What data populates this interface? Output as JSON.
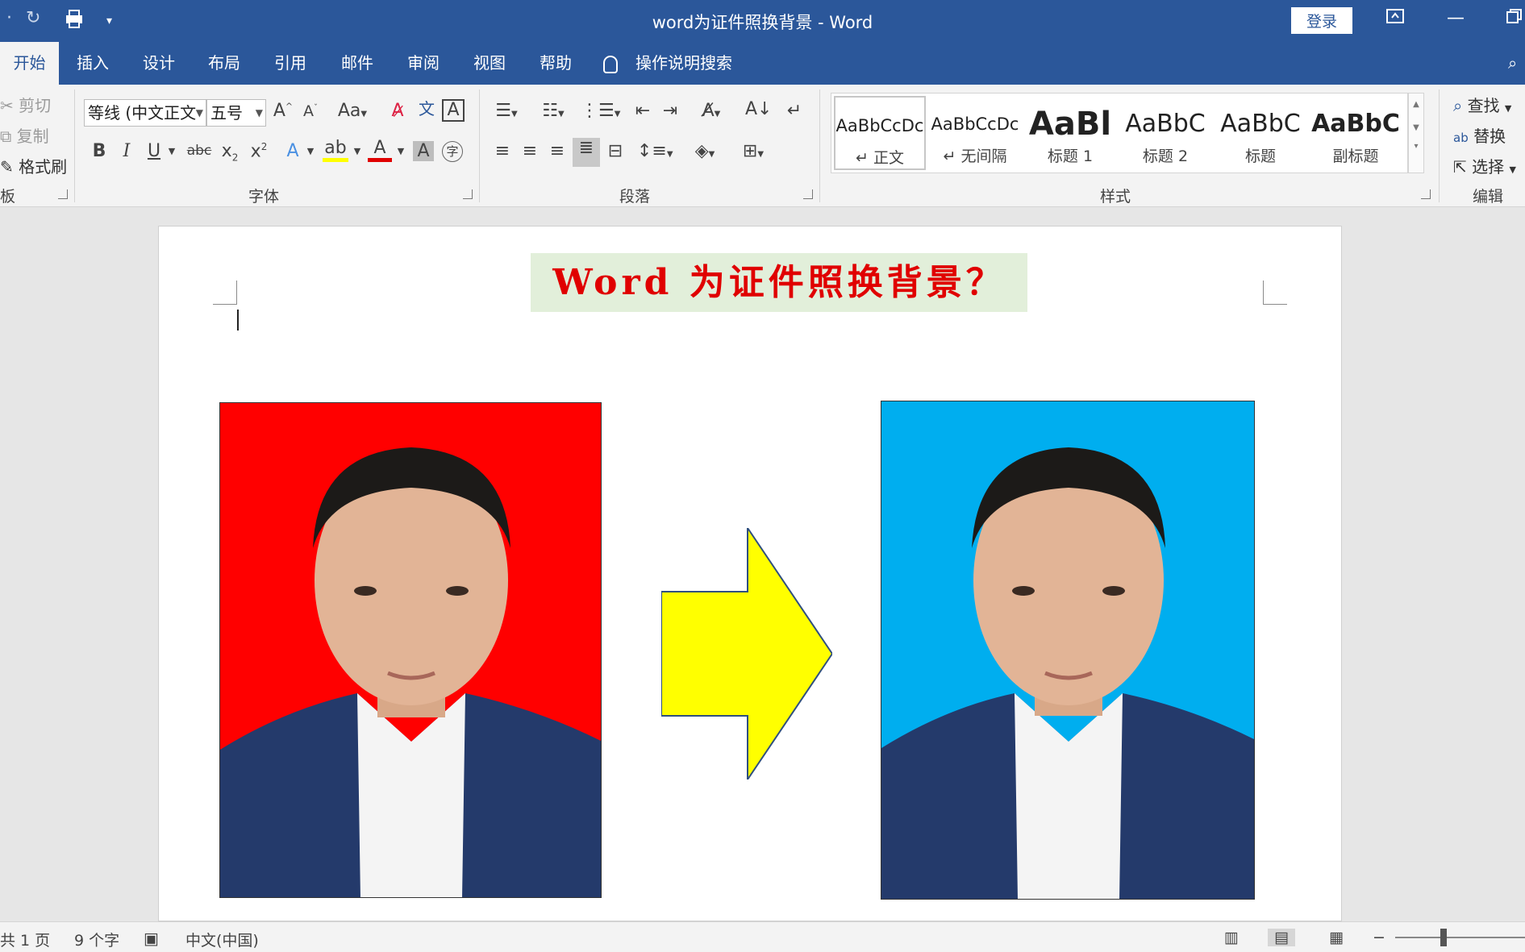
{
  "titlebar": {
    "title": "word为证件照换背景  -  Word",
    "login": "登录",
    "qat_undo_icon": "undo-icon",
    "qat_redo_icon": "redo-icon",
    "qat_print_icon": "print-preview-icon"
  },
  "tabs": [
    "开始",
    "插入",
    "设计",
    "布局",
    "引用",
    "邮件",
    "审阅",
    "视图",
    "帮助"
  ],
  "tell_me": "操作说明搜索",
  "ribbon": {
    "clipboard": {
      "cut": "剪切",
      "copy": "复制",
      "format_painter": "格式刷",
      "label": "板"
    },
    "font": {
      "name": "等线 (中文正文",
      "size": "五号",
      "label": "字体",
      "change_case": "Aa"
    },
    "paragraph": {
      "label": "段落"
    },
    "styles": {
      "label": "样式",
      "items": [
        {
          "sample": "AaBbCcDc",
          "name": "↵ 正文"
        },
        {
          "sample": "AaBbCcDc",
          "name": "↵ 无间隔"
        },
        {
          "sample": "AaBl",
          "name": "标题 1"
        },
        {
          "sample": "AaBbC",
          "name": "标题 2"
        },
        {
          "sample": "AaBbC",
          "name": "标题"
        },
        {
          "sample": "AaBbC",
          "name": "副标题"
        }
      ]
    },
    "editing": {
      "find": "查找",
      "replace": "替换",
      "select": "选择",
      "label": "编辑"
    }
  },
  "document": {
    "heading": "Word 为证件照换背景？",
    "heading_bg": "#e2efda",
    "heading_color": "#e00000",
    "photo_before_bg": "#ff0000",
    "photo_after_bg": "#00aeef",
    "arrow_fill": "#ffff00",
    "arrow_stroke": "#2f4f7f"
  },
  "status": {
    "page": "共 1 页",
    "words": "9 个字",
    "language": "中文(中国)"
  },
  "colors": {
    "accent": "#2b579a",
    "ribbon_bg": "#f3f3f3"
  }
}
